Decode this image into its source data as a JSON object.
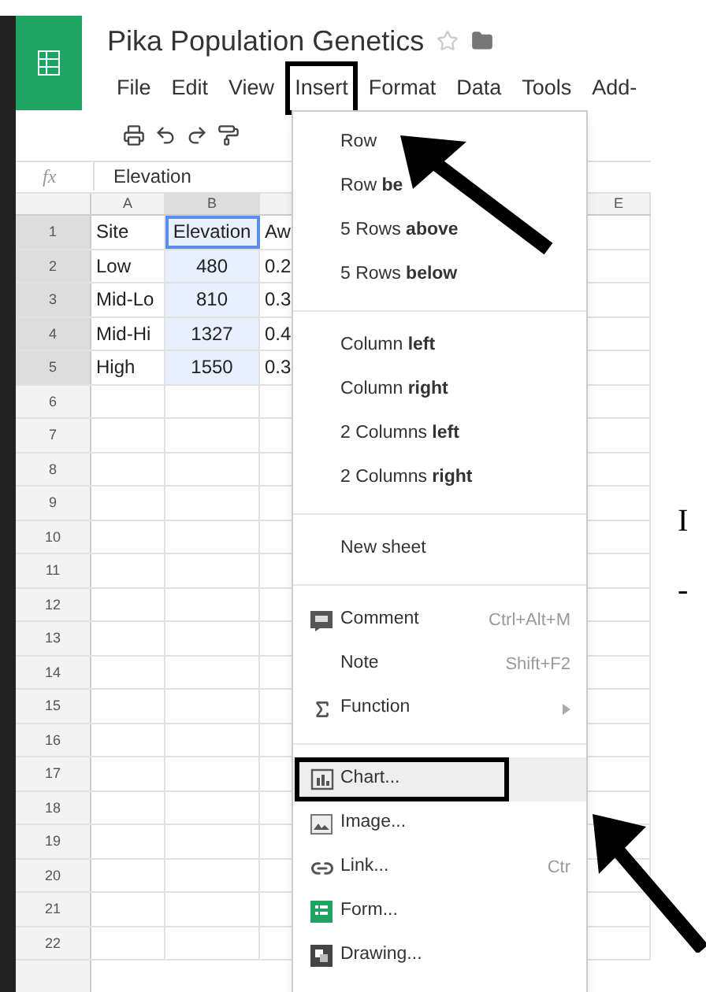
{
  "app": {
    "title": "Pika Population Genetics",
    "menu": [
      {
        "label": "File",
        "selected": false
      },
      {
        "label": "Edit",
        "selected": false
      },
      {
        "label": "View",
        "selected": false
      },
      {
        "label": "Insert",
        "selected": true
      },
      {
        "label": "Format",
        "selected": false
      },
      {
        "label": "Data",
        "selected": false
      },
      {
        "label": "Tools",
        "selected": false
      },
      {
        "label": "Add-",
        "selected": false
      }
    ]
  },
  "formula_bar": {
    "label": "fx",
    "value": "Elevation"
  },
  "sheet": {
    "columns": [
      {
        "label": "A",
        "selected": false
      },
      {
        "label": "B",
        "selected": true
      },
      {
        "label": "E",
        "selected": false
      }
    ],
    "rows": [
      {
        "number": "1",
        "selected": true,
        "cells": [
          {
            "text": "Site",
            "selected": false
          },
          {
            "text": "Elevation",
            "selected": true
          },
          {
            "text": "Aw",
            "selected": false
          }
        ]
      },
      {
        "number": "2",
        "selected": true,
        "cells": [
          {
            "text": "Low",
            "selected": false
          },
          {
            "text": "480",
            "selected": true
          },
          {
            "text": "0.2",
            "selected": false
          }
        ]
      },
      {
        "number": "3",
        "selected": true,
        "cells": [
          {
            "text": "Mid-Lo",
            "selected": false
          },
          {
            "text": "810",
            "selected": true
          },
          {
            "text": "0.3",
            "selected": false
          }
        ]
      },
      {
        "number": "4",
        "selected": true,
        "cells": [
          {
            "text": "Mid-Hi",
            "selected": false
          },
          {
            "text": "1327",
            "selected": true
          },
          {
            "text": "0.4",
            "selected": false
          }
        ]
      },
      {
        "number": "5",
        "selected": true,
        "cells": [
          {
            "text": "High",
            "selected": false
          },
          {
            "text": "1550",
            "selected": true
          },
          {
            "text": "0.3",
            "selected": false
          }
        ]
      },
      {
        "number": "6",
        "selected": false
      },
      {
        "number": "7",
        "selected": false
      },
      {
        "number": "8",
        "selected": false
      },
      {
        "number": "9",
        "selected": false
      },
      {
        "number": "10",
        "selected": false
      },
      {
        "number": "11",
        "selected": false
      },
      {
        "number": "12",
        "selected": false
      },
      {
        "number": "13",
        "selected": false
      },
      {
        "number": "14",
        "selected": false
      },
      {
        "number": "15",
        "selected": false
      },
      {
        "number": "16",
        "selected": false
      },
      {
        "number": "17",
        "selected": false
      },
      {
        "number": "18",
        "selected": false
      },
      {
        "number": "19",
        "selected": false
      },
      {
        "number": "20",
        "selected": false
      },
      {
        "number": "21",
        "selected": false
      },
      {
        "number": "22",
        "selected": false
      }
    ]
  },
  "insert_menu": {
    "sections": [
      [
        {
          "label": "Row",
          "highlighted": false
        },
        {
          "label": "Row **be**",
          "highlighted": false
        },
        {
          "label": "5 Rows **above**",
          "highlighted": false
        },
        {
          "label": "5 Rows **below**",
          "highlighted": false
        }
      ],
      [
        {
          "label": "Column **left**",
          "highlighted": false
        },
        {
          "label": "Column **right**",
          "highlighted": false
        },
        {
          "label": "2 Columns **left**",
          "highlighted": false
        },
        {
          "label": "2 Columns **right**",
          "highlighted": false
        }
      ],
      [
        {
          "label": "New sheet",
          "highlighted": false
        }
      ],
      [
        {
          "label": "Comment",
          "shortcut": "Ctrl+Alt+M",
          "highlighted": false
        },
        {
          "label": "Note",
          "shortcut": "Shift+F2",
          "highlighted": false
        },
        {
          "label": "Function",
          "submenu": true,
          "highlighted": false
        }
      ],
      [
        {
          "label": "Chart...",
          "highlighted": true
        },
        {
          "label": "Image...",
          "highlighted": false
        },
        {
          "label": "Link...",
          "shortcut": "Ctr",
          "highlighted": false
        },
        {
          "label": "Form...",
          "highlighted": false
        },
        {
          "label": "Drawing...",
          "highlighted": false
        }
      ]
    ]
  },
  "margin_text": [
    "I",
    "-"
  ]
}
